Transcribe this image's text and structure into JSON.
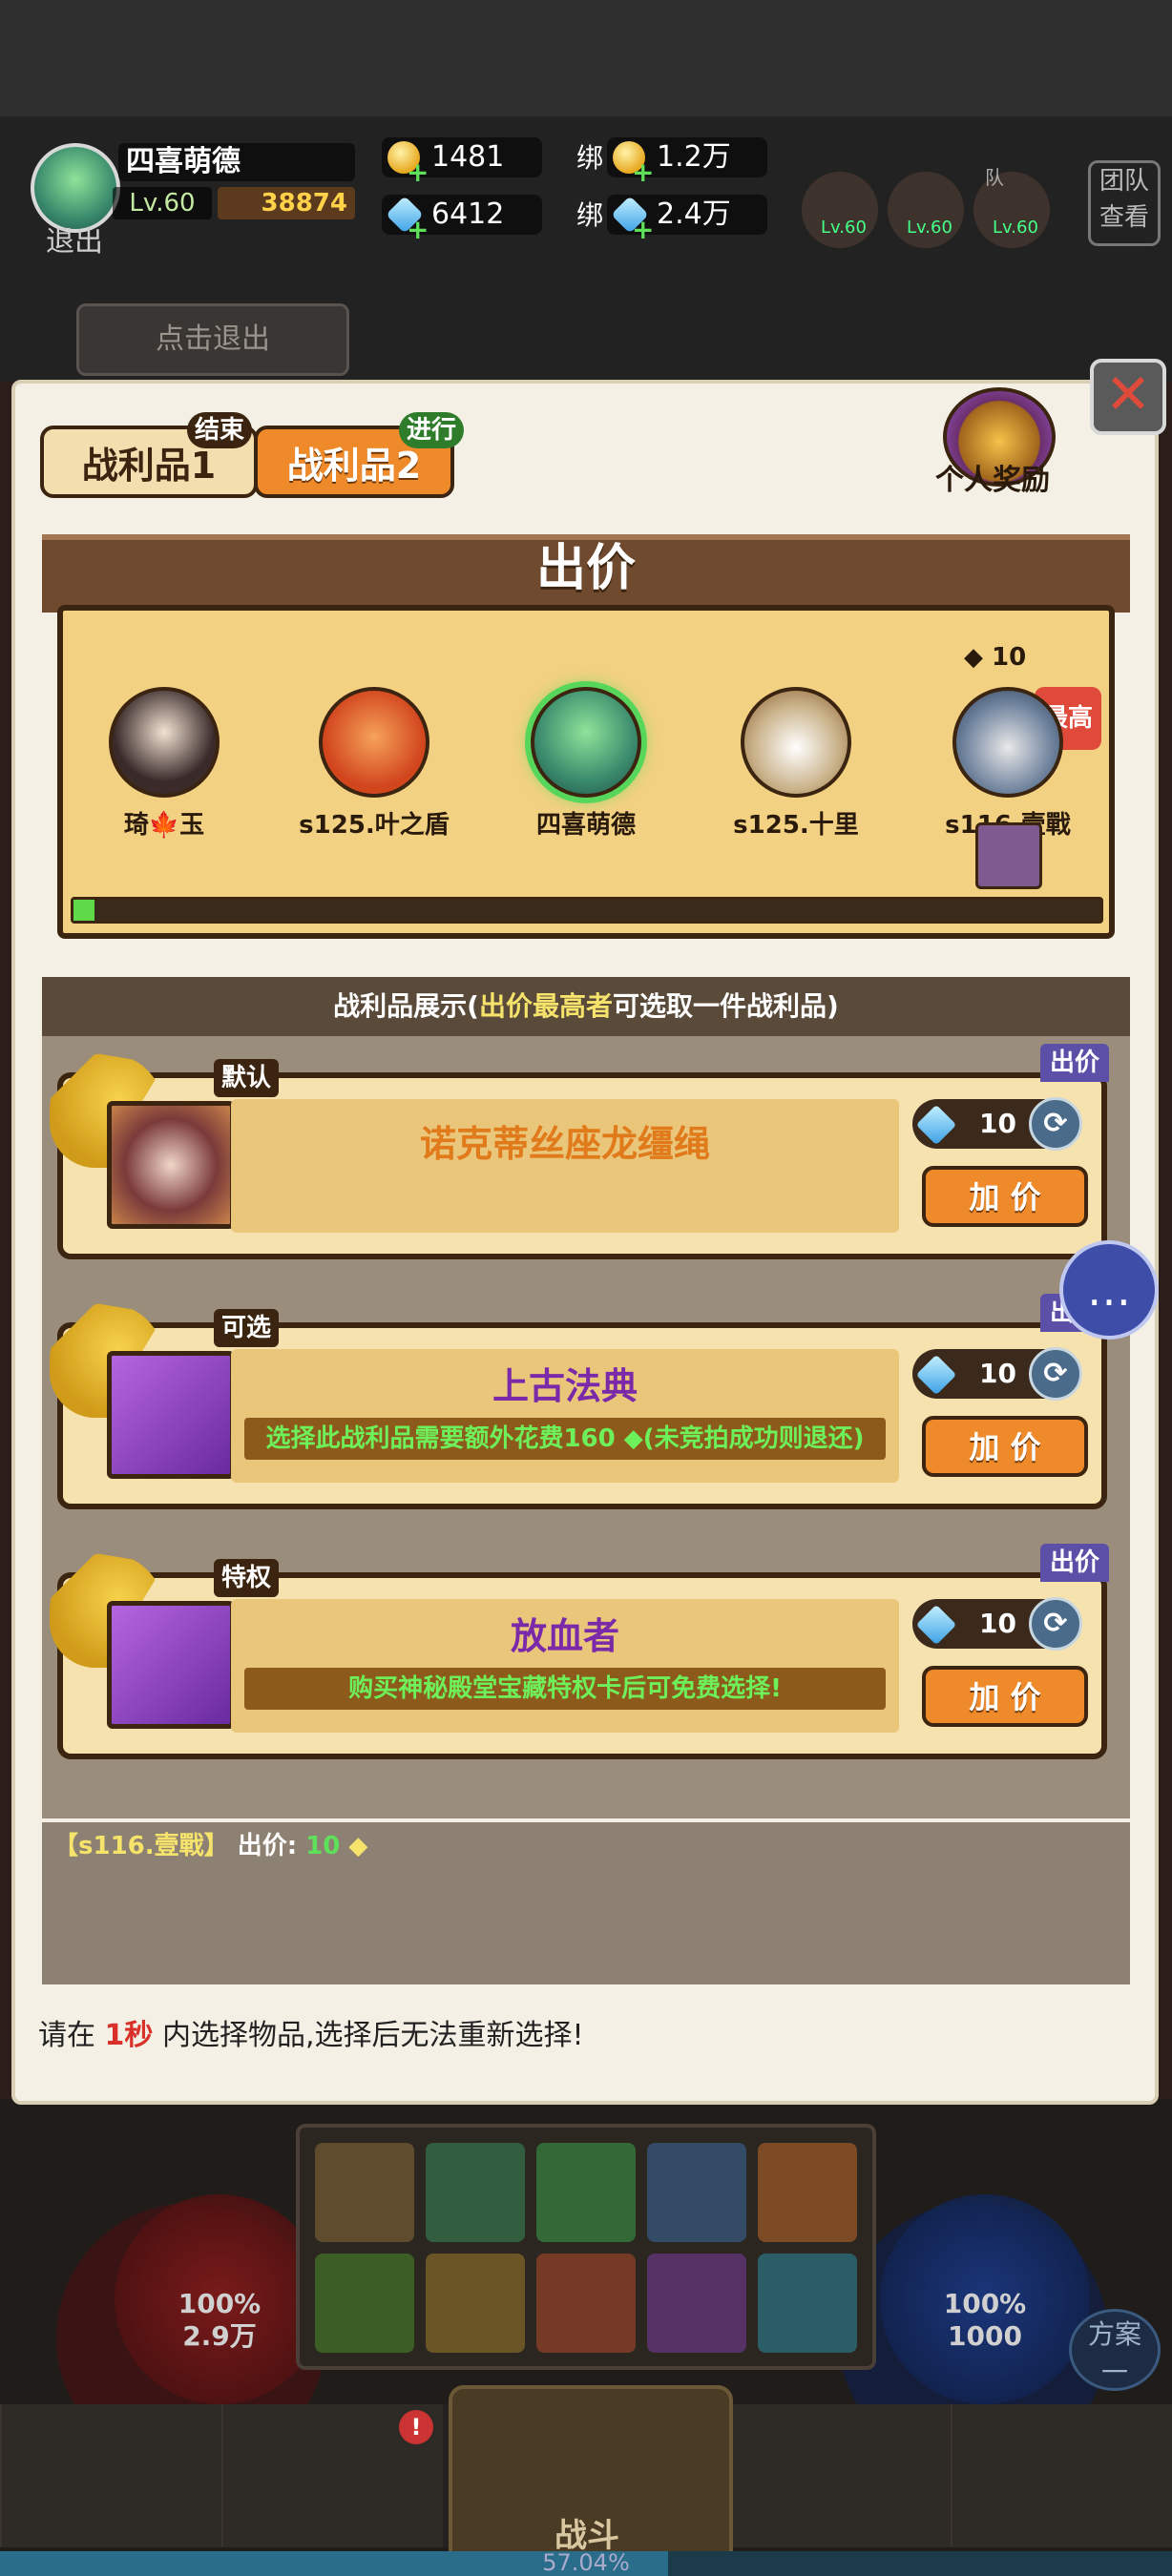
{
  "player": {
    "name": "四喜萌德",
    "level": "Lv.60",
    "power": "38874",
    "exit_label": "退出"
  },
  "resources": {
    "gold": "1481",
    "gems": "6412",
    "bind_label": "绑",
    "bound_gold": "1.2万",
    "bound_gems": "2.4万"
  },
  "team": {
    "levels": [
      "Lv.60",
      "Lv.60",
      "Lv.60"
    ],
    "view_label_1": "团队",
    "view_label_2": "查看",
    "side_label": "队"
  },
  "click_exit": "点击退出",
  "panel": {
    "tabs": [
      {
        "label": "战利品1",
        "status": "结束"
      },
      {
        "label": "战利品2",
        "status": "进行"
      }
    ],
    "personal_reward": "个人奖励",
    "bid_title": "出价",
    "bidders": [
      "琦🍁玉",
      "s125.叶之盾",
      "四喜萌德",
      "s125.十里",
      "s116.壹戰"
    ],
    "top_bid_value": "10",
    "highest_label": "最高",
    "bid_progress": 0.02,
    "loot_header_prefix": "战利品展示(",
    "loot_header_highlight1": "出价",
    "loot_header_highlight2": "最高者",
    "loot_header_suffix": "可选取一件战利品)",
    "items": [
      {
        "badge": "默认",
        "name": "诺克蒂丝座龙缰绳",
        "name_color": "#e07a1a",
        "sub": "",
        "price": "10",
        "flag": "出价",
        "button": "加 价"
      },
      {
        "badge": "可选",
        "name": "上古法典",
        "name_color": "#7a2aa8",
        "sub": "选择此战利品需要额外花费160 ◆(未竞拍成功则退还)",
        "price": "10",
        "flag": "出价",
        "button": "加 价"
      },
      {
        "badge": "特权",
        "name": "放血者",
        "name_color": "#7a2aa8",
        "sub": "购买神秘殿堂宝藏特权卡后可免费选择!",
        "price": "10",
        "flag": "出价",
        "button": "加 价"
      }
    ],
    "log": {
      "name": "【s116.壹戰】",
      "label": "出价:",
      "value": "10"
    },
    "notice_prefix": "请在",
    "notice_time": "1秒",
    "notice_suffix": "内选择物品,选择后无法重新选择!"
  },
  "hud": {
    "hp_pct": "100%",
    "hp_val": "2.9万",
    "mp_pct": "100%",
    "mp_val": "1000",
    "plan_1": "方案",
    "plan_2": "一",
    "battle": "战斗",
    "notify": "!",
    "xp": "57.04%"
  }
}
